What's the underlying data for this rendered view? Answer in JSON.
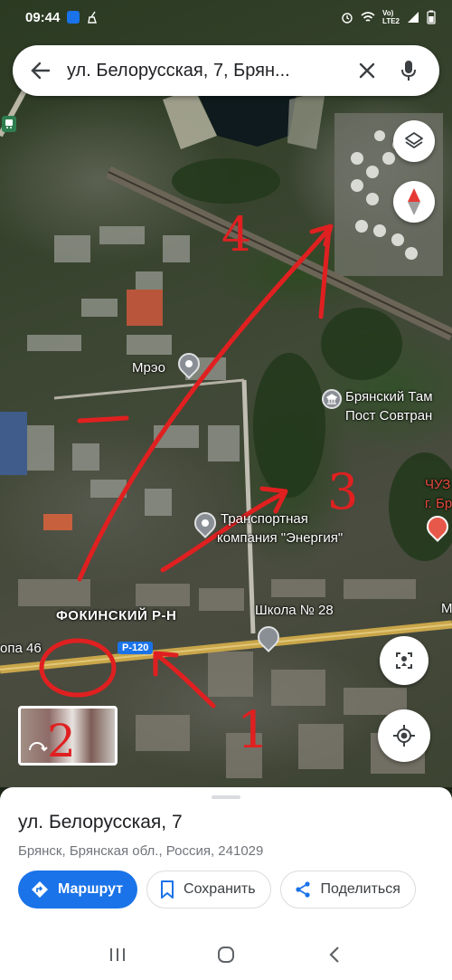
{
  "status_bar": {
    "time": "09:44",
    "network": "Vo) LTE2",
    "network_line1": "Vo)",
    "network_line2": "LTE2"
  },
  "search": {
    "query": "ул. Белорусская, 7, Брян..."
  },
  "map": {
    "labels": {
      "mreo": "Мрэо",
      "customs_1": "Брянский Там",
      "customs_2": "Пост Совтран",
      "energy_1": "Транспортная",
      "energy_2": "компания \"Энергия\"",
      "czu_1": "ЧУЗ",
      "czu_2": "г. Бр",
      "school": "Школа № 28",
      "district": "ФОКИНСКИЙ Р-Н",
      "stop": "опа 46",
      "road": "Р-120",
      "edge_letter": "М"
    },
    "annotations": {
      "n1": "1",
      "n2": "2",
      "n3": "3",
      "n4": "4"
    },
    "colors": {
      "annotation": "#e02020",
      "road": "#c9a64a",
      "road_badge": "#1a73e8"
    }
  },
  "controls": {
    "layers": "layers-icon",
    "compass": "compass-icon",
    "streetview": "streetview-icon",
    "mylocation": "my-location-icon"
  },
  "place": {
    "title": "ул. Белорусская, 7",
    "address": "Брянск, Брянская обл., Россия, 241029"
  },
  "actions": {
    "route": "Маршрут",
    "save": "Сохранить",
    "share": "Поделиться"
  },
  "accent": "#1a73e8"
}
